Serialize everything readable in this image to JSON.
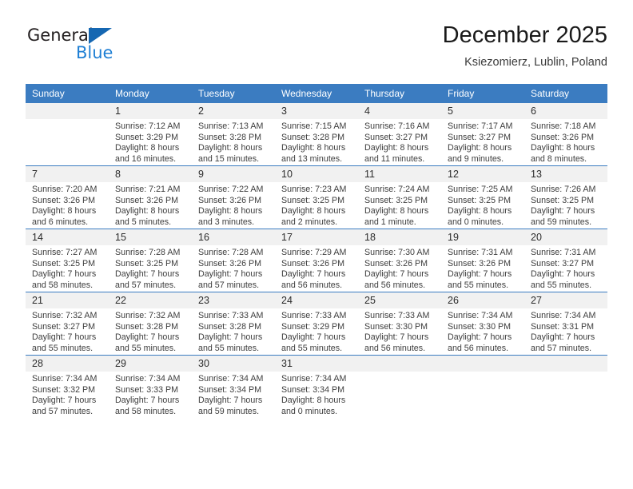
{
  "brand": {
    "name_top": "General",
    "name_bottom": "Blue",
    "triangle_color": "#1567b2",
    "blue_color": "#1e7fd4"
  },
  "header": {
    "title": "December 2025",
    "subtitle": "Ksiezomierz, Lublin, Poland"
  },
  "theme": {
    "header_blue": "#3b7cc1",
    "daynum_bg": "#f1f1f1",
    "text": "#3d3d3d"
  },
  "weekdays": [
    "Sunday",
    "Monday",
    "Tuesday",
    "Wednesday",
    "Thursday",
    "Friday",
    "Saturday"
  ],
  "weeks": [
    [
      {
        "day": "",
        "sunrise": "",
        "sunset": "",
        "daylight1": "",
        "daylight2": ""
      },
      {
        "day": "1",
        "sunrise": "Sunrise: 7:12 AM",
        "sunset": "Sunset: 3:29 PM",
        "daylight1": "Daylight: 8 hours",
        "daylight2": "and 16 minutes."
      },
      {
        "day": "2",
        "sunrise": "Sunrise: 7:13 AM",
        "sunset": "Sunset: 3:28 PM",
        "daylight1": "Daylight: 8 hours",
        "daylight2": "and 15 minutes."
      },
      {
        "day": "3",
        "sunrise": "Sunrise: 7:15 AM",
        "sunset": "Sunset: 3:28 PM",
        "daylight1": "Daylight: 8 hours",
        "daylight2": "and 13 minutes."
      },
      {
        "day": "4",
        "sunrise": "Sunrise: 7:16 AM",
        "sunset": "Sunset: 3:27 PM",
        "daylight1": "Daylight: 8 hours",
        "daylight2": "and 11 minutes."
      },
      {
        "day": "5",
        "sunrise": "Sunrise: 7:17 AM",
        "sunset": "Sunset: 3:27 PM",
        "daylight1": "Daylight: 8 hours",
        "daylight2": "and 9 minutes."
      },
      {
        "day": "6",
        "sunrise": "Sunrise: 7:18 AM",
        "sunset": "Sunset: 3:26 PM",
        "daylight1": "Daylight: 8 hours",
        "daylight2": "and 8 minutes."
      }
    ],
    [
      {
        "day": "7",
        "sunrise": "Sunrise: 7:20 AM",
        "sunset": "Sunset: 3:26 PM",
        "daylight1": "Daylight: 8 hours",
        "daylight2": "and 6 minutes."
      },
      {
        "day": "8",
        "sunrise": "Sunrise: 7:21 AM",
        "sunset": "Sunset: 3:26 PM",
        "daylight1": "Daylight: 8 hours",
        "daylight2": "and 5 minutes."
      },
      {
        "day": "9",
        "sunrise": "Sunrise: 7:22 AM",
        "sunset": "Sunset: 3:26 PM",
        "daylight1": "Daylight: 8 hours",
        "daylight2": "and 3 minutes."
      },
      {
        "day": "10",
        "sunrise": "Sunrise: 7:23 AM",
        "sunset": "Sunset: 3:25 PM",
        "daylight1": "Daylight: 8 hours",
        "daylight2": "and 2 minutes."
      },
      {
        "day": "11",
        "sunrise": "Sunrise: 7:24 AM",
        "sunset": "Sunset: 3:25 PM",
        "daylight1": "Daylight: 8 hours",
        "daylight2": "and 1 minute."
      },
      {
        "day": "12",
        "sunrise": "Sunrise: 7:25 AM",
        "sunset": "Sunset: 3:25 PM",
        "daylight1": "Daylight: 8 hours",
        "daylight2": "and 0 minutes."
      },
      {
        "day": "13",
        "sunrise": "Sunrise: 7:26 AM",
        "sunset": "Sunset: 3:25 PM",
        "daylight1": "Daylight: 7 hours",
        "daylight2": "and 59 minutes."
      }
    ],
    [
      {
        "day": "14",
        "sunrise": "Sunrise: 7:27 AM",
        "sunset": "Sunset: 3:25 PM",
        "daylight1": "Daylight: 7 hours",
        "daylight2": "and 58 minutes."
      },
      {
        "day": "15",
        "sunrise": "Sunrise: 7:28 AM",
        "sunset": "Sunset: 3:25 PM",
        "daylight1": "Daylight: 7 hours",
        "daylight2": "and 57 minutes."
      },
      {
        "day": "16",
        "sunrise": "Sunrise: 7:28 AM",
        "sunset": "Sunset: 3:26 PM",
        "daylight1": "Daylight: 7 hours",
        "daylight2": "and 57 minutes."
      },
      {
        "day": "17",
        "sunrise": "Sunrise: 7:29 AM",
        "sunset": "Sunset: 3:26 PM",
        "daylight1": "Daylight: 7 hours",
        "daylight2": "and 56 minutes."
      },
      {
        "day": "18",
        "sunrise": "Sunrise: 7:30 AM",
        "sunset": "Sunset: 3:26 PM",
        "daylight1": "Daylight: 7 hours",
        "daylight2": "and 56 minutes."
      },
      {
        "day": "19",
        "sunrise": "Sunrise: 7:31 AM",
        "sunset": "Sunset: 3:26 PM",
        "daylight1": "Daylight: 7 hours",
        "daylight2": "and 55 minutes."
      },
      {
        "day": "20",
        "sunrise": "Sunrise: 7:31 AM",
        "sunset": "Sunset: 3:27 PM",
        "daylight1": "Daylight: 7 hours",
        "daylight2": "and 55 minutes."
      }
    ],
    [
      {
        "day": "21",
        "sunrise": "Sunrise: 7:32 AM",
        "sunset": "Sunset: 3:27 PM",
        "daylight1": "Daylight: 7 hours",
        "daylight2": "and 55 minutes."
      },
      {
        "day": "22",
        "sunrise": "Sunrise: 7:32 AM",
        "sunset": "Sunset: 3:28 PM",
        "daylight1": "Daylight: 7 hours",
        "daylight2": "and 55 minutes."
      },
      {
        "day": "23",
        "sunrise": "Sunrise: 7:33 AM",
        "sunset": "Sunset: 3:28 PM",
        "daylight1": "Daylight: 7 hours",
        "daylight2": "and 55 minutes."
      },
      {
        "day": "24",
        "sunrise": "Sunrise: 7:33 AM",
        "sunset": "Sunset: 3:29 PM",
        "daylight1": "Daylight: 7 hours",
        "daylight2": "and 55 minutes."
      },
      {
        "day": "25",
        "sunrise": "Sunrise: 7:33 AM",
        "sunset": "Sunset: 3:30 PM",
        "daylight1": "Daylight: 7 hours",
        "daylight2": "and 56 minutes."
      },
      {
        "day": "26",
        "sunrise": "Sunrise: 7:34 AM",
        "sunset": "Sunset: 3:30 PM",
        "daylight1": "Daylight: 7 hours",
        "daylight2": "and 56 minutes."
      },
      {
        "day": "27",
        "sunrise": "Sunrise: 7:34 AM",
        "sunset": "Sunset: 3:31 PM",
        "daylight1": "Daylight: 7 hours",
        "daylight2": "and 57 minutes."
      }
    ],
    [
      {
        "day": "28",
        "sunrise": "Sunrise: 7:34 AM",
        "sunset": "Sunset: 3:32 PM",
        "daylight1": "Daylight: 7 hours",
        "daylight2": "and 57 minutes."
      },
      {
        "day": "29",
        "sunrise": "Sunrise: 7:34 AM",
        "sunset": "Sunset: 3:33 PM",
        "daylight1": "Daylight: 7 hours",
        "daylight2": "and 58 minutes."
      },
      {
        "day": "30",
        "sunrise": "Sunrise: 7:34 AM",
        "sunset": "Sunset: 3:34 PM",
        "daylight1": "Daylight: 7 hours",
        "daylight2": "and 59 minutes."
      },
      {
        "day": "31",
        "sunrise": "Sunrise: 7:34 AM",
        "sunset": "Sunset: 3:34 PM",
        "daylight1": "Daylight: 8 hours",
        "daylight2": "and 0 minutes."
      },
      {
        "day": "",
        "sunrise": "",
        "sunset": "",
        "daylight1": "",
        "daylight2": ""
      },
      {
        "day": "",
        "sunrise": "",
        "sunset": "",
        "daylight1": "",
        "daylight2": ""
      },
      {
        "day": "",
        "sunrise": "",
        "sunset": "",
        "daylight1": "",
        "daylight2": ""
      }
    ]
  ]
}
